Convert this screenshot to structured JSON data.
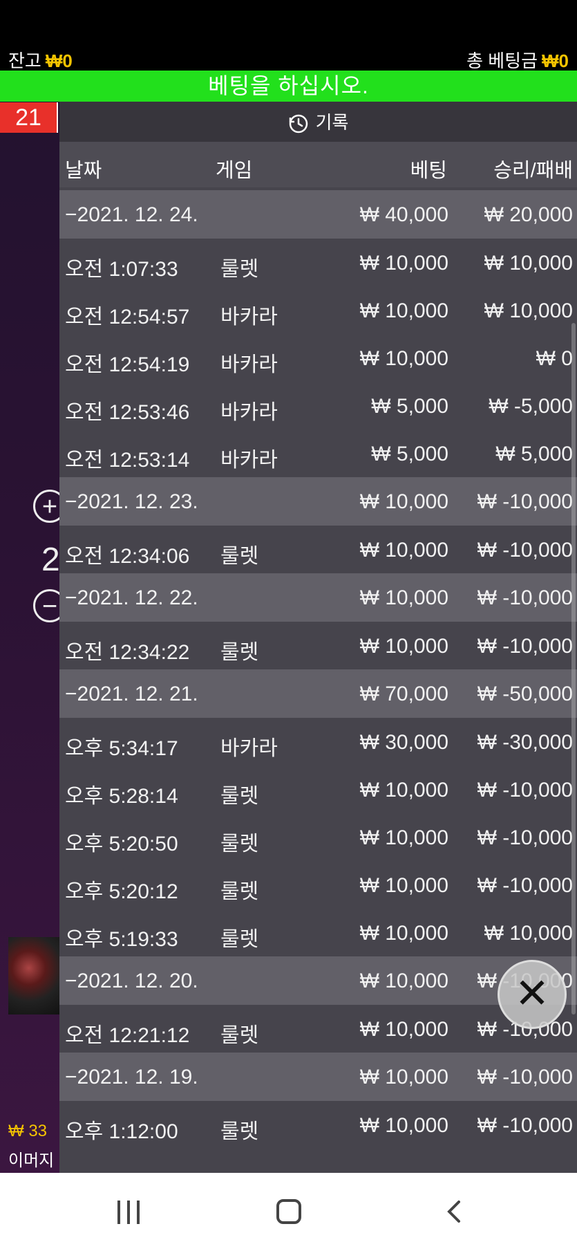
{
  "header": {
    "balance_label": "잔고",
    "balance_value": "₩0",
    "total_bet_label": "총 베팅금",
    "total_bet_value": "₩0"
  },
  "banner": {
    "text": "베팅을 하십시오."
  },
  "left": {
    "red_number": "21",
    "plus": "+",
    "number": "2",
    "minus": "−",
    "jackpot": "₩ 33",
    "image_text": "이머지"
  },
  "history": {
    "title": "기록",
    "columns": {
      "date": "날짜",
      "game": "게임",
      "bet": "베팅",
      "win_loss": "승리/패배"
    },
    "rows": [
      {
        "kind": "day",
        "date": "−2021. 12. 24.",
        "game": "",
        "bet": "₩ 40,000",
        "result": "₩ 20,000"
      },
      {
        "kind": "item",
        "date": "오전 1:07:33",
        "game": "룰렛",
        "bet": "₩ 10,000",
        "result": "₩ 10,000"
      },
      {
        "kind": "item",
        "date": "오전 12:54:57",
        "game": "바카라",
        "bet": "₩ 10,000",
        "result": "₩ 10,000"
      },
      {
        "kind": "item",
        "date": "오전 12:54:19",
        "game": "바카라",
        "bet": "₩ 10,000",
        "result": "₩ 0"
      },
      {
        "kind": "item",
        "date": "오전 12:53:46",
        "game": "바카라",
        "bet": "₩ 5,000",
        "result": "₩ -5,000"
      },
      {
        "kind": "item",
        "date": "오전 12:53:14",
        "game": "바카라",
        "bet": "₩ 5,000",
        "result": "₩ 5,000"
      },
      {
        "kind": "day",
        "date": "−2021. 12. 23.",
        "game": "",
        "bet": "₩ 10,000",
        "result": "₩ -10,000"
      },
      {
        "kind": "item",
        "date": "오전 12:34:06",
        "game": "룰렛",
        "bet": "₩ 10,000",
        "result": "₩ -10,000"
      },
      {
        "kind": "day",
        "date": "−2021. 12. 22.",
        "game": "",
        "bet": "₩ 10,000",
        "result": "₩ -10,000"
      },
      {
        "kind": "item",
        "date": "오전 12:34:22",
        "game": "룰렛",
        "bet": "₩ 10,000",
        "result": "₩ -10,000"
      },
      {
        "kind": "day",
        "date": "−2021. 12. 21.",
        "game": "",
        "bet": "₩ 70,000",
        "result": "₩ -50,000"
      },
      {
        "kind": "item",
        "date": "오후 5:34:17",
        "game": "바카라",
        "bet": "₩ 30,000",
        "result": "₩ -30,000"
      },
      {
        "kind": "item",
        "date": "오후 5:28:14",
        "game": "룰렛",
        "bet": "₩ 10,000",
        "result": "₩ -10,000"
      },
      {
        "kind": "item",
        "date": "오후 5:20:50",
        "game": "룰렛",
        "bet": "₩ 10,000",
        "result": "₩ -10,000"
      },
      {
        "kind": "item",
        "date": "오후 5:20:12",
        "game": "룰렛",
        "bet": "₩ 10,000",
        "result": "₩ -10,000"
      },
      {
        "kind": "item",
        "date": "오후 5:19:33",
        "game": "룰렛",
        "bet": "₩ 10,000",
        "result": "₩ 10,000"
      },
      {
        "kind": "day",
        "date": "−2021. 12. 20.",
        "game": "",
        "bet": "₩ 10,000",
        "result": "₩ -10,000"
      },
      {
        "kind": "item",
        "date": "오전 12:21:12",
        "game": "룰렛",
        "bet": "₩ 10,000",
        "result": "₩ -10,000"
      },
      {
        "kind": "day",
        "date": "−2021. 12. 19.",
        "game": "",
        "bet": "₩ 10,000",
        "result": "₩ -10,000"
      },
      {
        "kind": "item",
        "date": "오후 1:12:00",
        "game": "룰렛",
        "bet": "₩ 10,000",
        "result": "₩ -10,000"
      }
    ]
  },
  "icons": {
    "history": "history-clock-icon",
    "close": "close-icon",
    "nav_recent": "recent-apps-icon",
    "nav_home": "home-icon",
    "nav_back": "back-icon"
  },
  "colors": {
    "banner_green": "#22e01c",
    "amount_yellow": "#f5c400",
    "badge_red": "#e8302a"
  }
}
